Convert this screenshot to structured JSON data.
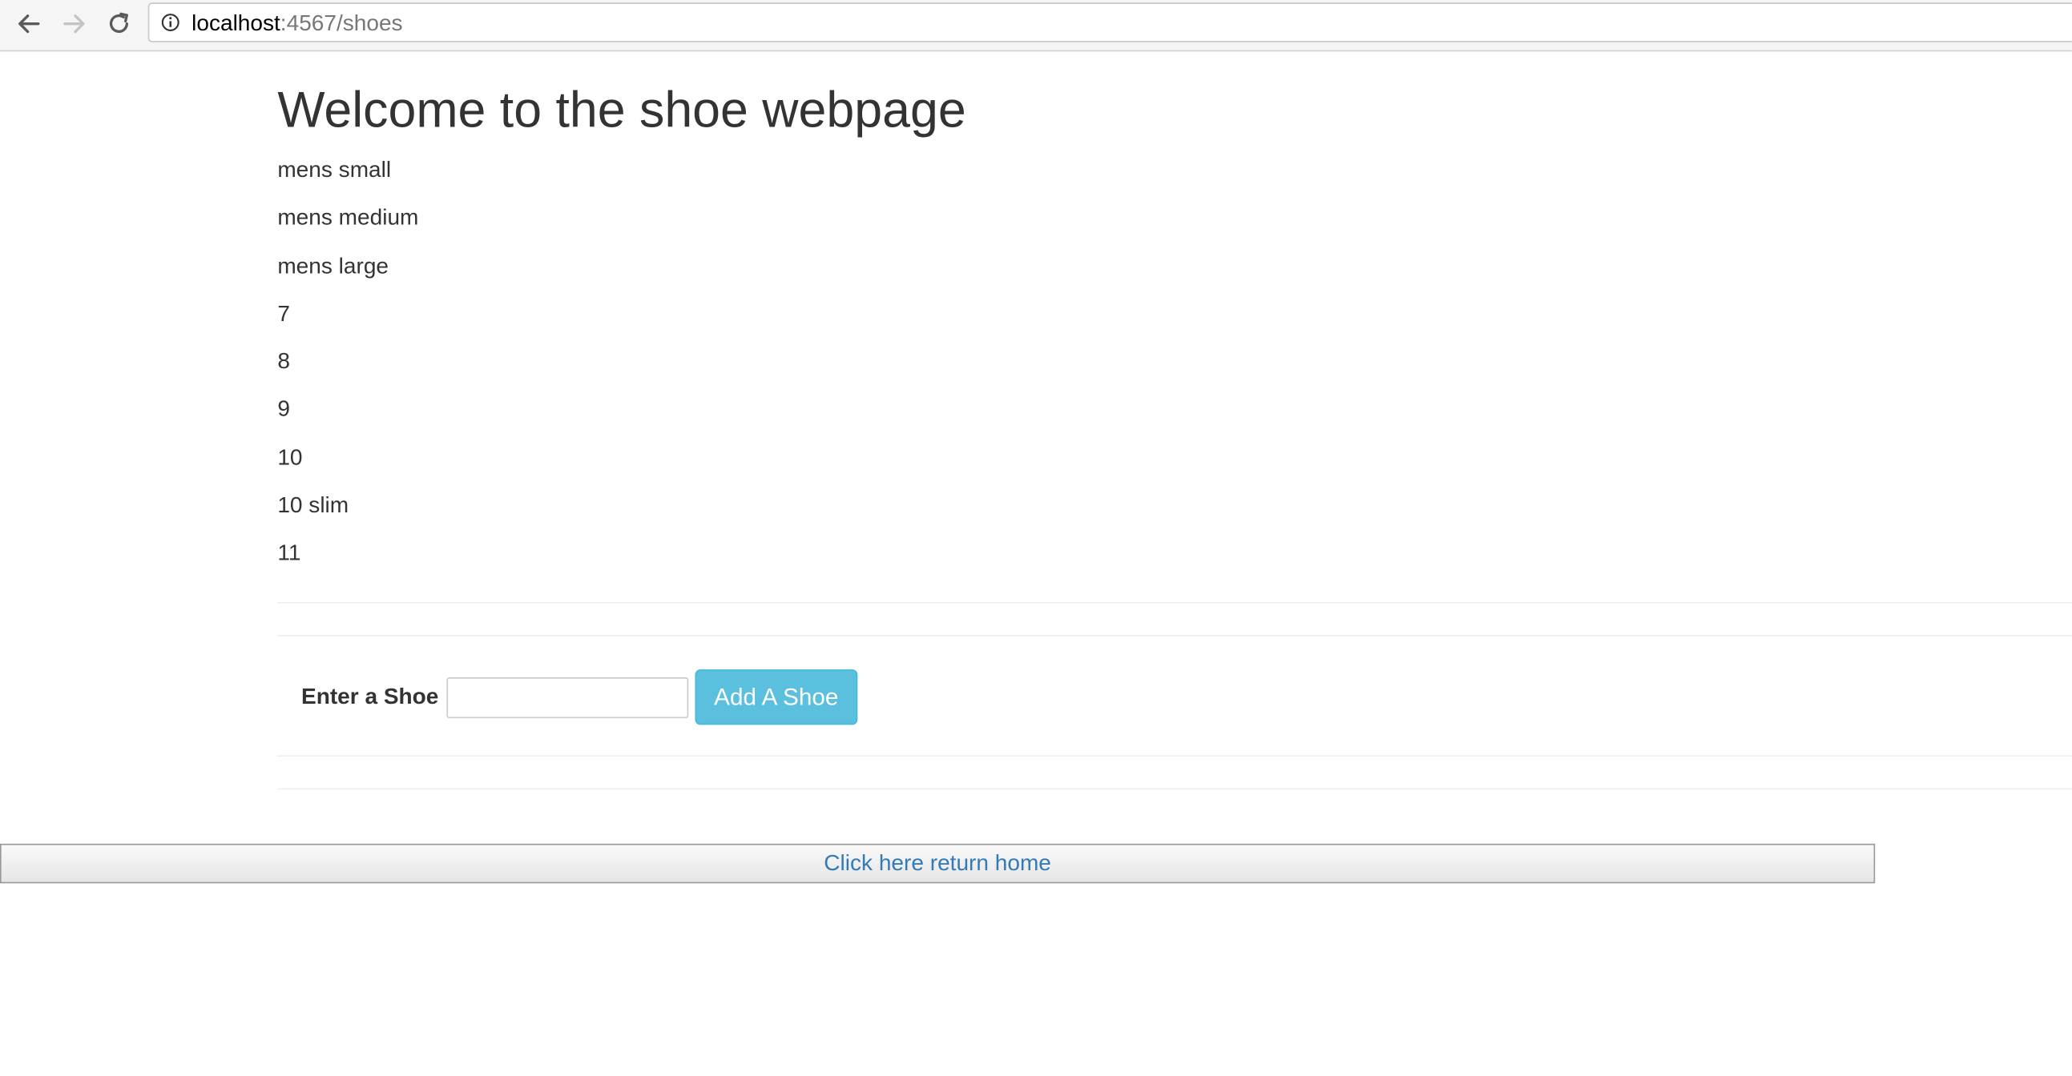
{
  "browser": {
    "url_host": "localhost",
    "url_rest": ":4567/shoes",
    "icons": {
      "back": "arrow-left-icon",
      "forward": "arrow-right-icon",
      "reload": "reload-icon",
      "info": "info-icon"
    }
  },
  "page": {
    "title": "Welcome to the shoe webpage",
    "shoes": [
      "mens small",
      "mens medium",
      "mens large",
      "7",
      "8",
      "9",
      "10",
      "10 slim",
      "11"
    ],
    "form": {
      "label": "Enter a Shoe",
      "input_value": "",
      "button_label": "Add A Shoe"
    },
    "home_link": "Click here return home"
  },
  "colors": {
    "button_bg": "#5bc0de",
    "link": "#337ab7",
    "text": "#333333"
  }
}
